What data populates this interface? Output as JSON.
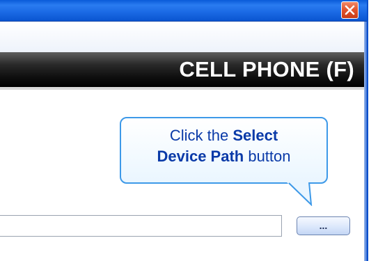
{
  "window": {
    "close_icon": "close-icon"
  },
  "header": {
    "title": "CELL PHONE (F)"
  },
  "callout": {
    "prefix": "Click the ",
    "bold1": "Select",
    "bold2": "Device Path",
    "suffix": " button"
  },
  "device_path": {
    "value": "",
    "browse_label": "..."
  },
  "colors": {
    "titlebar": "#1c6be6",
    "close": "#e2552f",
    "callout_border": "#3d99e8",
    "callout_text": "#0a3aa8",
    "header_band": "#000000"
  }
}
